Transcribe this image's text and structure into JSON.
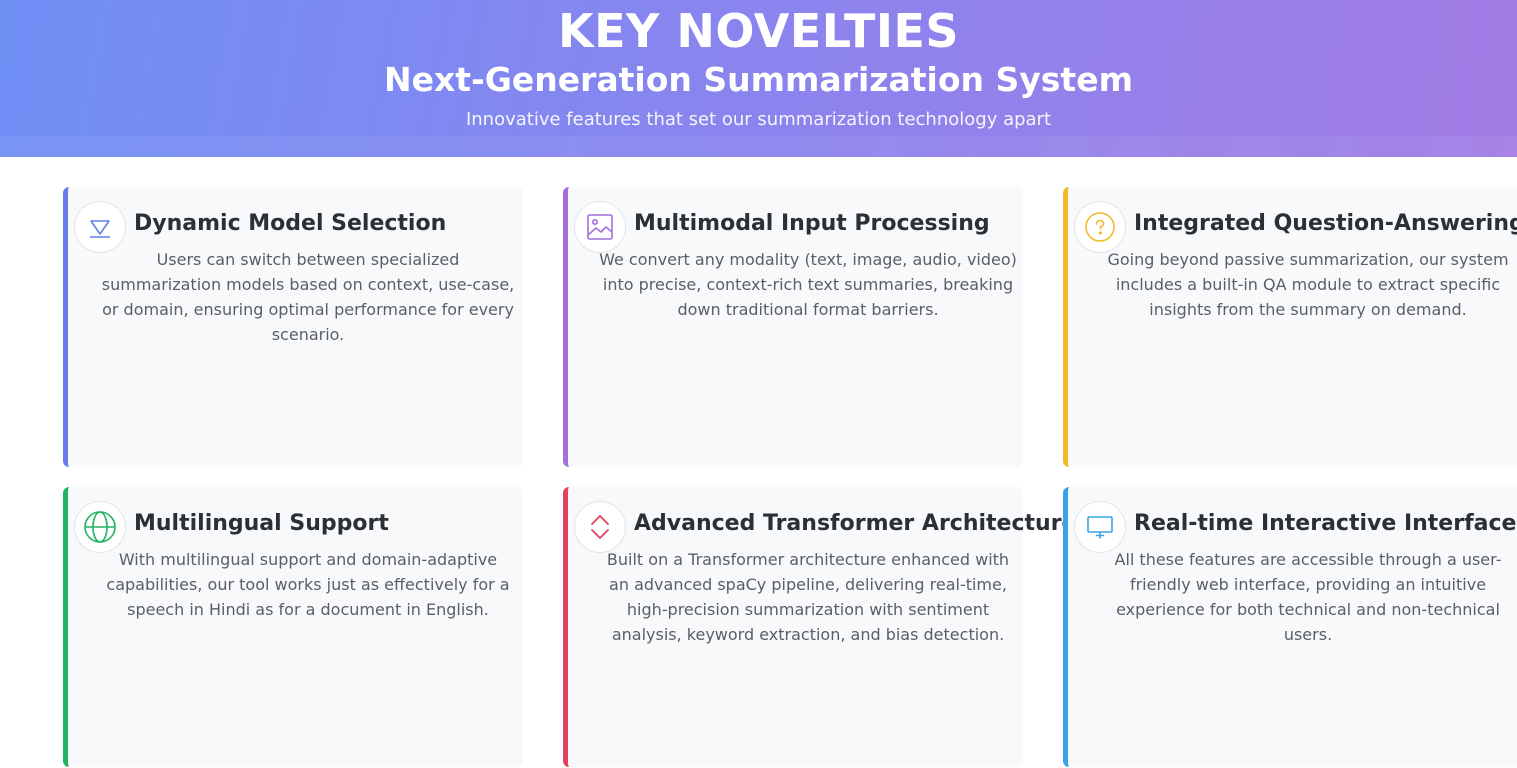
{
  "header": {
    "title": "KEY NOVELTIES",
    "subtitle": "Next-Generation Summarization System",
    "tagline": "Innovative features that set our summarization technology apart"
  },
  "cards": [
    {
      "title": "Dynamic Model Selection",
      "description": "Users can switch between specialized summarization models based on context, use-case, or domain, ensuring optimal performance for every scenario.",
      "icon": "diamond-icon",
      "color": "#667eea"
    },
    {
      "title": "Multimodal Input Processing",
      "description": "We convert any modality (text, image, audio, video) into precise, context-rich text summaries, breaking down traditional format barriers.",
      "icon": "image-icon",
      "color": "#a26fdc"
    },
    {
      "title": "Integrated Question-Answering",
      "description": "Going beyond passive summarization, our system includes a built-in QA module to extract specific insights from the summary on demand.",
      "icon": "question-icon",
      "color": "#f2b928"
    },
    {
      "title": "Multilingual Support",
      "description": "With multilingual support and domain-adaptive capabilities, our tool works just as effectively for a speech in Hindi as for a document in English.",
      "icon": "globe-icon",
      "color": "#21b35f"
    },
    {
      "title": "Advanced Transformer Architecture",
      "description": "Built on a Transformer architecture enhanced with an advanced spaCy pipeline, delivering real-time, high-precision summarization with sentiment analysis, keyword extraction, and bias detection.",
      "icon": "chevrons-icon",
      "color": "#e4405e"
    },
    {
      "title": "Real-time Interactive Interface",
      "description": "All these features are accessible through a user-friendly web interface, providing an intuitive experience for both technical and non-technical users.",
      "icon": "monitor-icon",
      "color": "#3aa3e8"
    }
  ]
}
